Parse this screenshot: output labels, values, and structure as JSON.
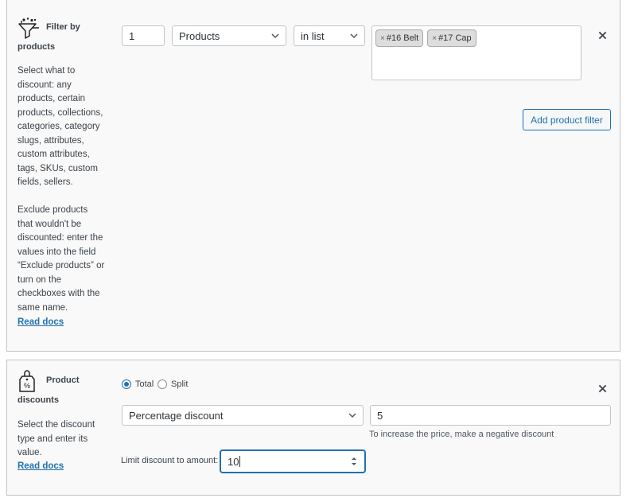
{
  "filter_section": {
    "title_line1": "Filter by",
    "title_line2": "products",
    "description": "Select what to\ndiscount: any\nproducts, certain\nproducts, collections,\ncategories, category\nslugs, attributes,\ncustom attributes,\ntags, SKUs, custom\nfields, sellers.\n\nExclude products\nthat wouldn't be\ndiscounted: enter the\nvalues into the field\n“Exclude products” or\nturn on the\ncheckboxes with the\nsame name.",
    "read_docs": "Read docs",
    "quantity_value": "1",
    "type_select": "Products",
    "condition_select": "in list",
    "tags": [
      {
        "remove": "×",
        "label": "#16 Belt"
      },
      {
        "remove": "×",
        "label": "#17 Cap"
      }
    ],
    "add_button": "Add product filter",
    "icon": "funnel-icon"
  },
  "discount_section": {
    "title_line1": "Product",
    "title_line2": "discounts",
    "description": "Select the discount\ntype and enter its\nvalue.",
    "read_docs": "Read docs",
    "radio_total": "Total",
    "radio_split": "Split",
    "selected_mode": "Total",
    "discount_type": "Percentage discount",
    "discount_value": "5",
    "hint": "To increase the price, make a negative discount",
    "limit_label": "Limit discount to amount:",
    "limit_value": "10",
    "icon": "price-tag-icon"
  },
  "colors": {
    "accent": "#2271b1",
    "panel_bg": "#f9f9f9",
    "border": "#c3c4c7"
  }
}
